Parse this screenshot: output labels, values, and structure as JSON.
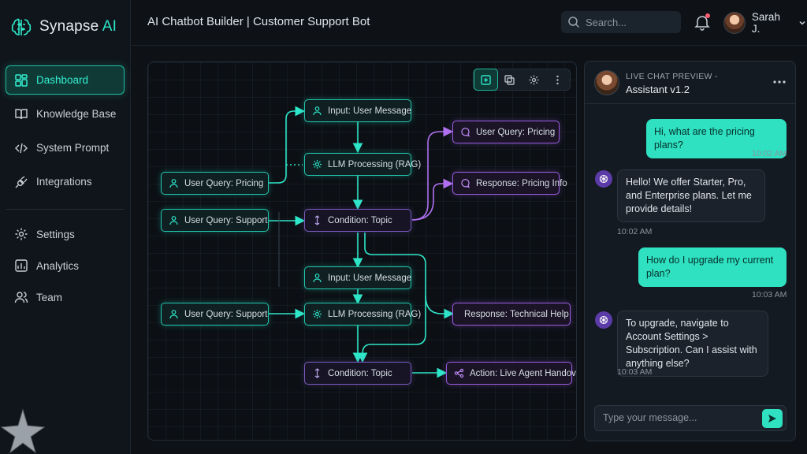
{
  "brand": {
    "name_primary": "Synapse",
    "name_accent": "AI",
    "logo_icon": "brain-icon"
  },
  "sidebar": {
    "items": [
      {
        "label": "Dashboard",
        "icon": "dashboard-icon",
        "active": true
      },
      {
        "label": "Knowledge Base",
        "icon": "book-icon",
        "active": false
      },
      {
        "label": "System Prompt",
        "icon": "code-icon",
        "active": false
      },
      {
        "label": "Integrations",
        "icon": "plug-icon",
        "active": false
      }
    ],
    "secondary_items": [
      {
        "label": "Settings",
        "icon": "gear-icon"
      },
      {
        "label": "Analytics",
        "icon": "analytics-icon"
      },
      {
        "label": "Team",
        "icon": "team-icon"
      }
    ]
  },
  "header": {
    "title": "AI Chatbot Builder | Customer Support Bot",
    "search_placeholder": "Search...",
    "notification_count_indicator": true,
    "user_name": "Sarah J."
  },
  "canvas": {
    "toolbar": [
      {
        "icon": "add-node-icon",
        "active": true
      },
      {
        "icon": "duplicate-icon",
        "active": false
      },
      {
        "icon": "gear-icon",
        "active": false
      },
      {
        "icon": "more-vertical-icon",
        "active": false
      }
    ],
    "nodes": {
      "input_1": "Input: User Message",
      "llm_1": "LLM Processing (RAG)",
      "query_pricing": "User Query: Pricing",
      "query_support_1": "User Query: Support",
      "condition_1": "Condition: Topic",
      "out_query_pricing": "User Query: Pricing",
      "out_pricing_info": "Response: Pricing Info",
      "input_2": "Input: User Message",
      "llm_2": "LLM Processing (RAG)",
      "query_support_2": "User Query: Support",
      "tech_help": "Response: Technical Help",
      "condition_2": "Condition: Topic",
      "handover": "Action: Live Agent Handover"
    }
  },
  "chat": {
    "subtitle": "LIVE CHAT PREVIEW -",
    "title": "Assistant v1.2",
    "messages": [
      {
        "from": "user",
        "text": "Hi, what are the pricing plans?",
        "time": "10:02 AM"
      },
      {
        "from": "bot",
        "text": "Hello! We offer Starter, Pro, and Enterprise plans. Let me provide details!",
        "time": "10:02 AM"
      },
      {
        "from": "user",
        "text": "How do I upgrade my current plan?",
        "time": "10:03 AM"
      },
      {
        "from": "bot",
        "text": "To upgrade, navigate to Account Settings > Subscription. Can I assist with anything else?",
        "time": "10:03 AM"
      }
    ],
    "input_placeholder": "Type your message..."
  },
  "colors": {
    "accent_teal": "#2ee6c9",
    "accent_purple": "#9a5ce0",
    "background": "#0e1217"
  }
}
